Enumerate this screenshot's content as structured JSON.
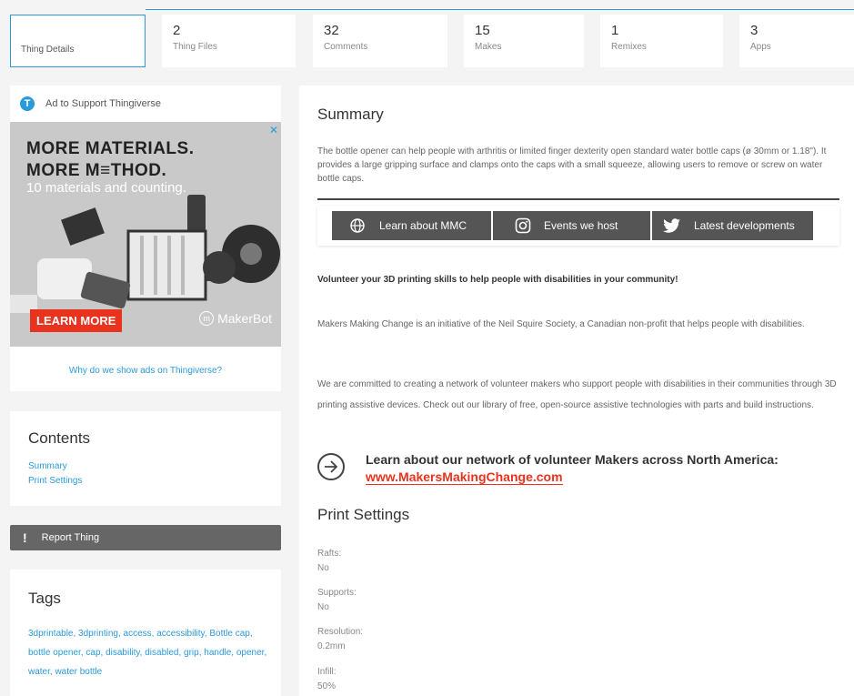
{
  "tabs": [
    {
      "count": "",
      "label": "Thing Details"
    },
    {
      "count": "2",
      "label": "Thing Files"
    },
    {
      "count": "32",
      "label": "Comments"
    },
    {
      "count": "15",
      "label": "Makes"
    },
    {
      "count": "1",
      "label": "Remixes"
    },
    {
      "count": "3",
      "label": "Apps"
    }
  ],
  "ad": {
    "header": "Ad to Support Thingiverse",
    "line1": "MORE MATERIALS.",
    "line2": "MORE M≡THOD.",
    "sub": "10 materials and counting.",
    "cta": "LEARN MORE",
    "brand": "MakerBot",
    "why": "Why do we show ads on Thingiverse?"
  },
  "contents": {
    "title": "Contents",
    "links": [
      "Summary",
      "Print Settings"
    ]
  },
  "report": "Report Thing",
  "tags": {
    "title": "Tags",
    "text": "3dprintable, 3dprinting, access, accessibility, Bottle cap, bottle opener, cap, disability, disabled, grip, handle, opener, water, water bottle"
  },
  "summary": {
    "title": "Summary",
    "text": "The bottle opener can help people with arthritis or limited finger dexterity open standard water bottle caps (ø 30mm or 1.18\"). It provides a large gripping surface and clamps onto the caps with a small squeeze, allowing users to remove or screw on water bottle caps.",
    "buttons": [
      "Learn about MMC",
      "Events we host",
      "Latest developments"
    ],
    "volunteer": "Volunteer your 3D printing skills to help people with disabilities in your community!",
    "para1": "Makers Making Change is an initiative of the Neil Squire Society, a Canadian non-profit that helps people with disabilities.",
    "para2": "We are committed to creating a network of volunteer makers who support people with disabilities in their communities through 3D printing assistive devices. Check out our library of free, open-source assistive technologies with parts and build instructions.",
    "network_title": "Learn about our network of volunteer Makers across North America:",
    "network_link": "www.MakersMakingChange.com"
  },
  "print_settings": {
    "title": "Print Settings",
    "items": [
      {
        "label": "Rafts:",
        "value": "No"
      },
      {
        "label": "Supports:",
        "value": "No"
      },
      {
        "label": "Resolution:",
        "value": "0.2mm"
      },
      {
        "label": "Infill:",
        "value": "50%"
      }
    ]
  },
  "colors": {
    "accent": "#2b9adb",
    "cta_red": "#e8331f",
    "dark_button": "#555555"
  }
}
